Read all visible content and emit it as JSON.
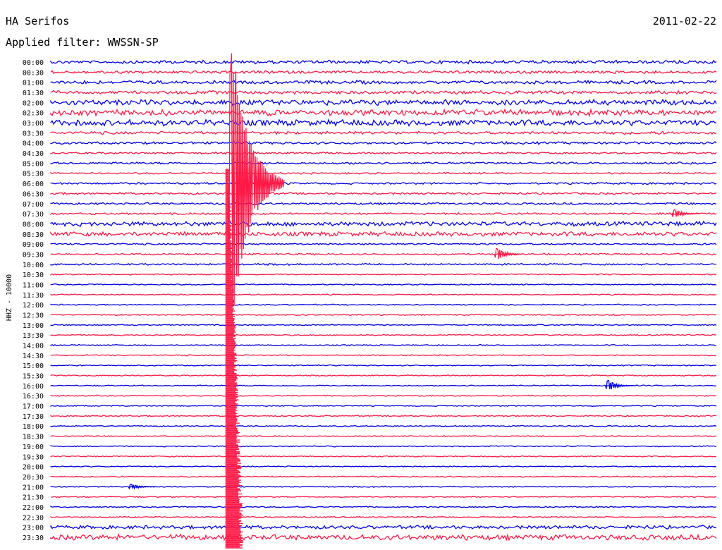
{
  "header": {
    "station": "HA Serifos",
    "date": "2011-02-22",
    "filter": "Applied filter: WWSSN-SP"
  },
  "axis": {
    "ylabel": "HHZ - 10000"
  },
  "colors": {
    "trace_a": "#0000e6",
    "trace_b": "#ff1a47",
    "background": "#ffffff"
  },
  "chart_data": {
    "type": "line",
    "title": "HA Serifos",
    "ylabel": "HHZ - 10000",
    "row_labels": [
      "00:00",
      "00:30",
      "01:00",
      "01:30",
      "02:00",
      "02:30",
      "03:00",
      "03:30",
      "04:00",
      "04:30",
      "05:00",
      "05:30",
      "06:00",
      "06:30",
      "07:00",
      "07:30",
      "08:00",
      "08:30",
      "09:00",
      "09:30",
      "10:00",
      "10:30",
      "11:00",
      "11:30",
      "12:00",
      "12:30",
      "13:00",
      "13:30",
      "14:00",
      "14:30",
      "15:00",
      "15:30",
      "16:00",
      "16:30",
      "17:00",
      "17:30",
      "18:00",
      "18:30",
      "19:00",
      "19:30",
      "20:00",
      "20:30",
      "21:00",
      "21:30",
      "22:00",
      "22:30",
      "23:00",
      "23:30"
    ],
    "row_minutes": 30,
    "noise_level": [
      0.35,
      0.3,
      0.35,
      0.35,
      0.55,
      0.6,
      0.6,
      0.3,
      0.25,
      0.2,
      0.22,
      0.18,
      0.2,
      0.2,
      0.2,
      0.2,
      0.45,
      0.45,
      0.18,
      0.18,
      0.18,
      0.12,
      0.12,
      0.12,
      0.12,
      0.12,
      0.12,
      0.12,
      0.12,
      0.12,
      0.12,
      0.12,
      0.12,
      0.12,
      0.12,
      0.12,
      0.12,
      0.12,
      0.12,
      0.12,
      0.12,
      0.12,
      0.12,
      0.12,
      0.12,
      0.12,
      0.35,
      0.55
    ],
    "events": [
      {
        "row": 19,
        "minute": 20.0,
        "amplitude": 14
      },
      {
        "row": 15,
        "minute": 28.0,
        "amplitude": 10
      },
      {
        "row": 32,
        "minute": 25.0,
        "amplitude": 12
      },
      {
        "row": 12,
        "minute": 8.0,
        "amplitude": 260
      },
      {
        "row": 42,
        "minute": 3.5,
        "amplitude": 6
      }
    ]
  }
}
